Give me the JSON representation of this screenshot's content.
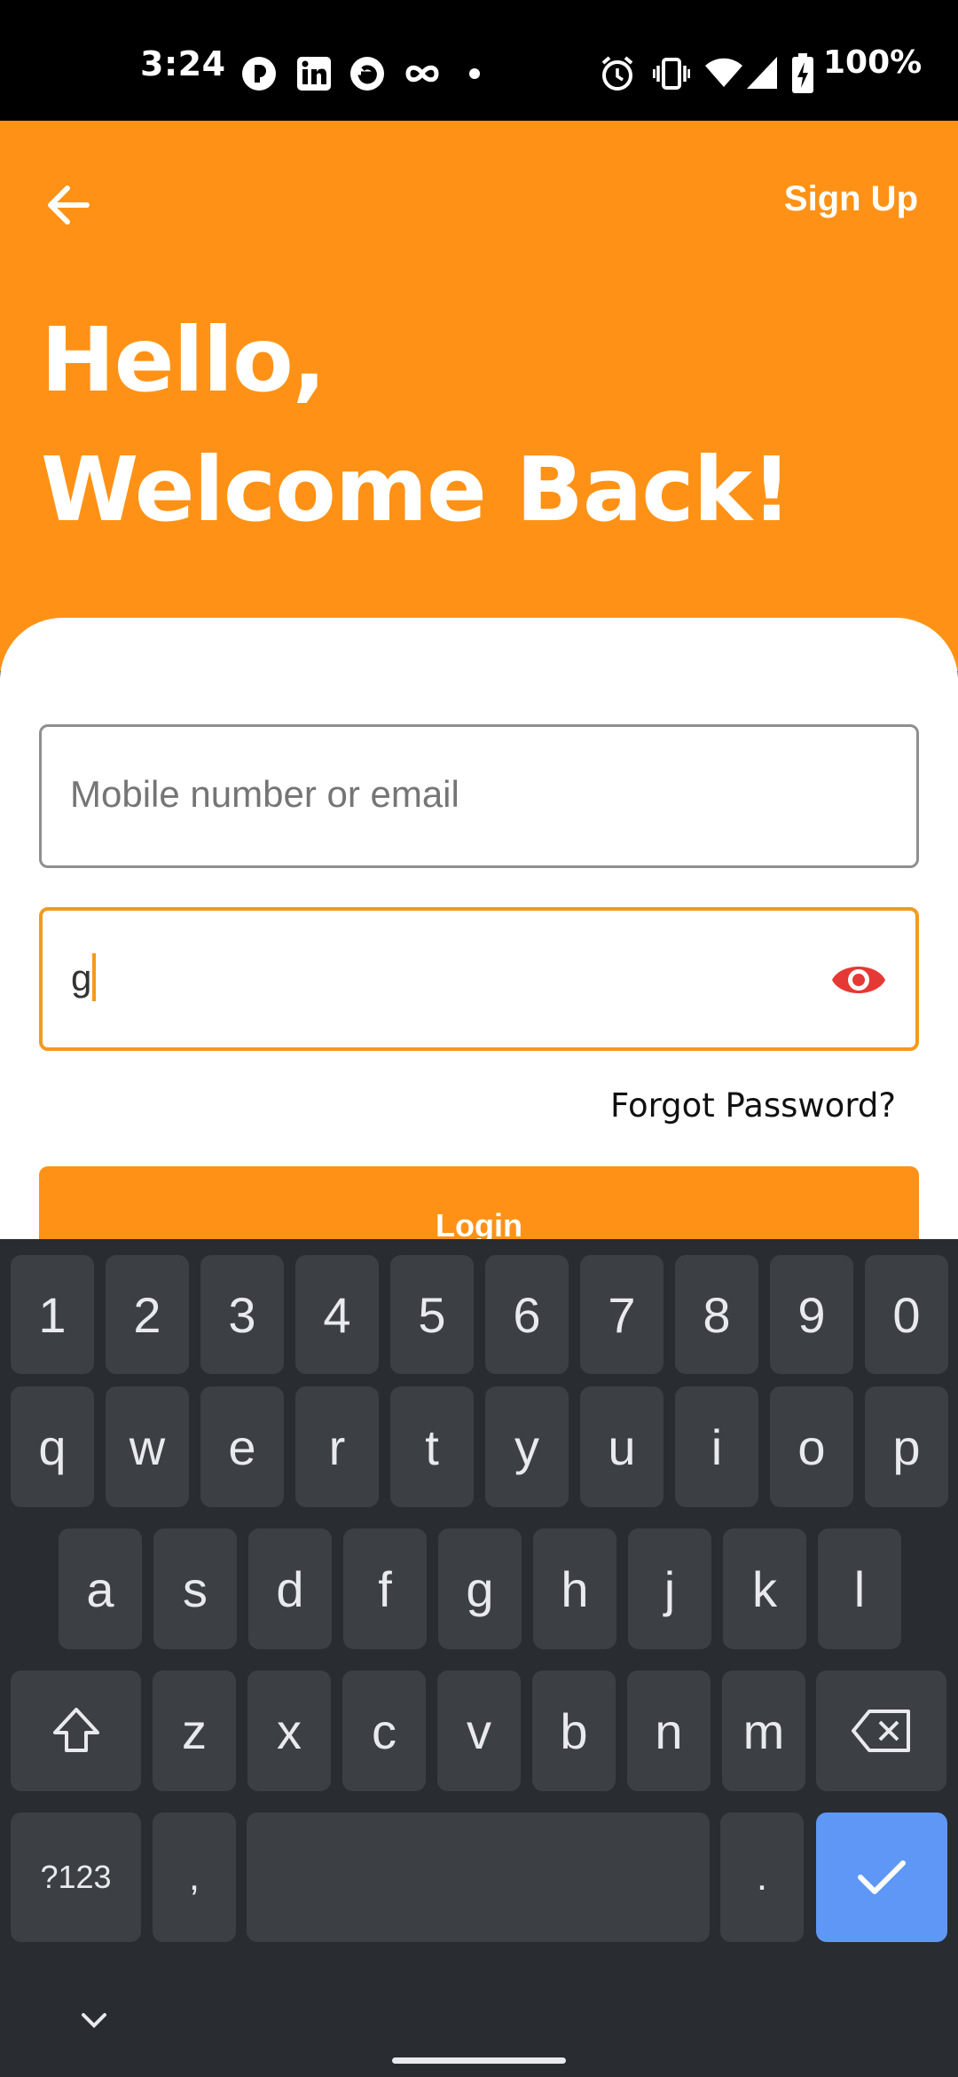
{
  "status_bar": {
    "time": "3:24",
    "battery": "100%",
    "left_icons": [
      "app-badge-icon",
      "linkedin-icon",
      "e-app-icon",
      "infinity-icon",
      "dot-icon"
    ],
    "right_icons": [
      "alarm-icon",
      "vibrate-icon",
      "wifi-icon",
      "signal-icon",
      "battery-charging-icon"
    ]
  },
  "header": {
    "signup_label": "Sign Up",
    "greeting_line1": "Hello,",
    "greeting_line2": "Welcome Back!"
  },
  "form": {
    "email_placeholder": "Mobile number or email",
    "email_value": "",
    "password_value": "g",
    "forgot_label": "Forgot Password?",
    "login_label": "Login"
  },
  "keyboard": {
    "row_numbers": [
      "1",
      "2",
      "3",
      "4",
      "5",
      "6",
      "7",
      "8",
      "9",
      "0"
    ],
    "row1": [
      "q",
      "w",
      "e",
      "r",
      "t",
      "y",
      "u",
      "i",
      "o",
      "p"
    ],
    "row2": [
      "a",
      "s",
      "d",
      "f",
      "g",
      "h",
      "j",
      "k",
      "l"
    ],
    "row3": [
      "z",
      "x",
      "c",
      "v",
      "b",
      "n",
      "m"
    ],
    "symbols_label": "?123",
    "comma": ",",
    "period": "."
  },
  "colors": {
    "brand_orange": "#ff9216",
    "focus_orange": "#f39a1d",
    "eye_red": "#e53935",
    "enter_blue": "#5e97f6"
  }
}
